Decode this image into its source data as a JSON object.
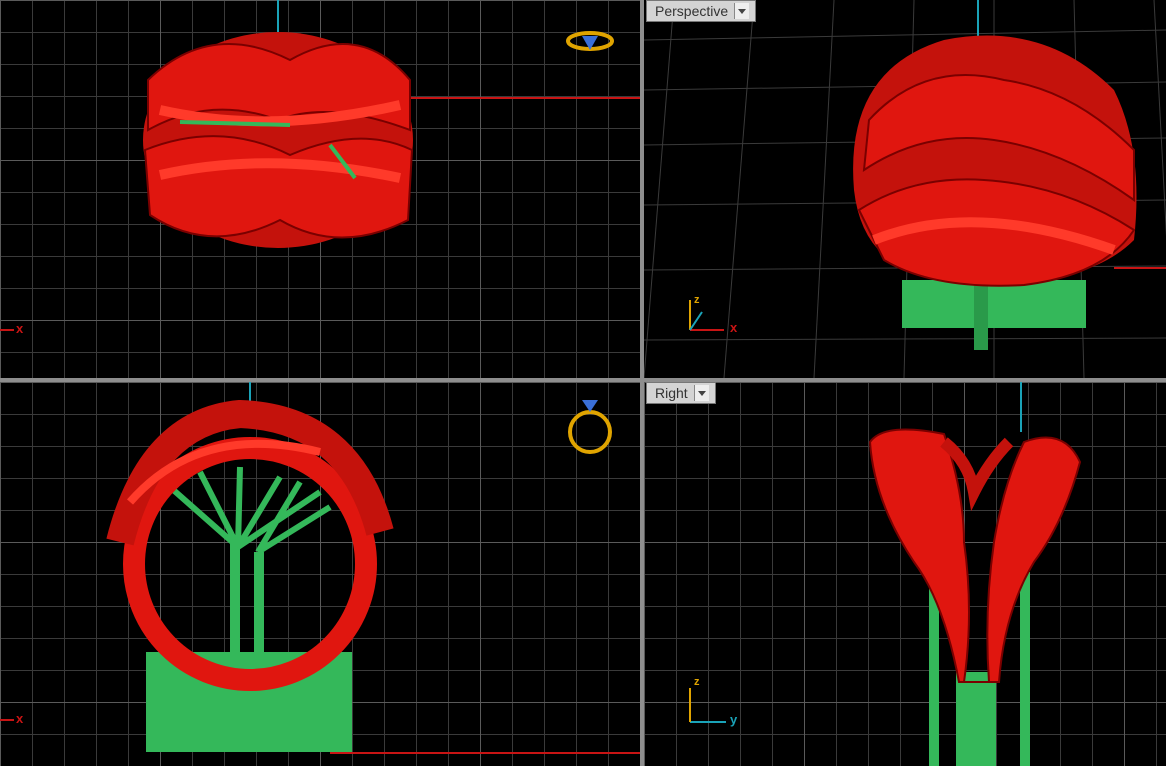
{
  "viewports": {
    "top": {
      "axis_x": "x"
    },
    "perspective": {
      "label": "Perspective",
      "axis_x": "x",
      "axis_z": "z"
    },
    "front": {
      "axis_x": "x"
    },
    "right": {
      "label": "Right",
      "axis_y": "y",
      "axis_z": "z"
    }
  },
  "colors": {
    "model": "#e0160f",
    "supports": "#34b85a",
    "axis_red": "#c81414",
    "axis_cyan": "#1aa3b8",
    "gizmo_gold": "#e0a400",
    "gizmo_blue": "#3a6fd8",
    "viewport_bg": "#000000",
    "grid": "#3a3a3a"
  },
  "icons": [
    "ring-gizmo-top-icon",
    "ring-gizmo-front-icon",
    "dropdown-arrow-icon"
  ]
}
